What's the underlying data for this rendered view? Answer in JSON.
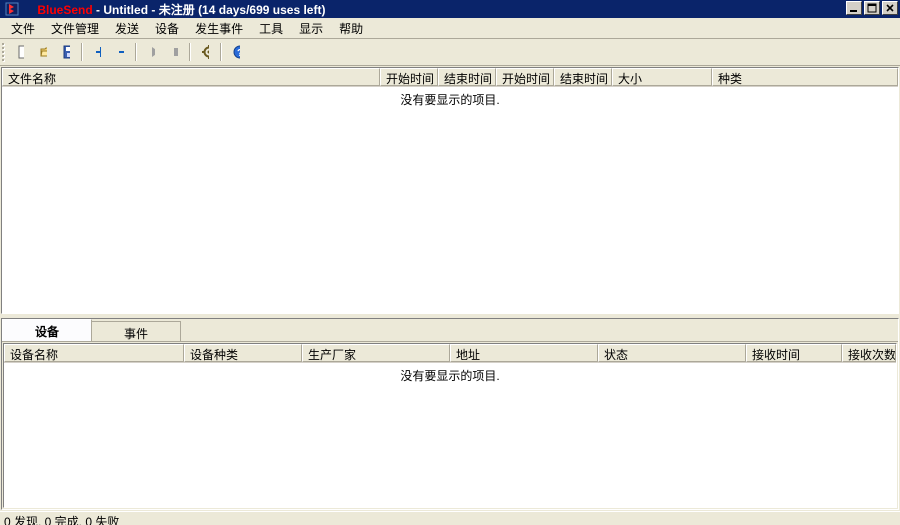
{
  "window": {
    "app_name": "BlueSend",
    "doc_name": "Untitled",
    "reg_status": "未注册",
    "trial_info": "(14 days/699 uses left)"
  },
  "menu": {
    "file": "文件",
    "file_mgmt": "文件管理",
    "send": "发送",
    "devices": "设备",
    "events": "发生事件",
    "tools": "工具",
    "display": "显示",
    "help": "帮助"
  },
  "toolbar": {
    "new_icon": "new-file-icon",
    "open_icon": "open-folder-icon",
    "save_icon": "save-disk-icon",
    "add_icon": "plus-icon",
    "remove_icon": "minus-icon",
    "play_icon": "play-icon",
    "stop_icon": "stop-icon",
    "settings_icon": "gear-icon",
    "help_icon": "help-icon"
  },
  "top_columns": {
    "c0": "文件名称",
    "c1": "开始时间",
    "c2": "结束时间",
    "c3": "开始时间",
    "c4": "结束时间",
    "c5": "大小",
    "c6": "种类"
  },
  "top_widths": [
    378,
    58,
    58,
    58,
    58,
    100,
    186
  ],
  "empty_text": "没有要显示的项目.",
  "tabs": {
    "devices": "设备",
    "events": "事件"
  },
  "bottom_columns": {
    "c0": "设备名称",
    "c1": "设备种类",
    "c2": "生产厂家",
    "c3": "地址",
    "c4": "状态",
    "c5": "接收时间",
    "c6": "接收次数"
  },
  "bottom_widths": [
    180,
    118,
    148,
    148,
    148,
    96,
    58
  ],
  "status": {
    "text": "0 发现, 0 完成, 0 失败"
  }
}
